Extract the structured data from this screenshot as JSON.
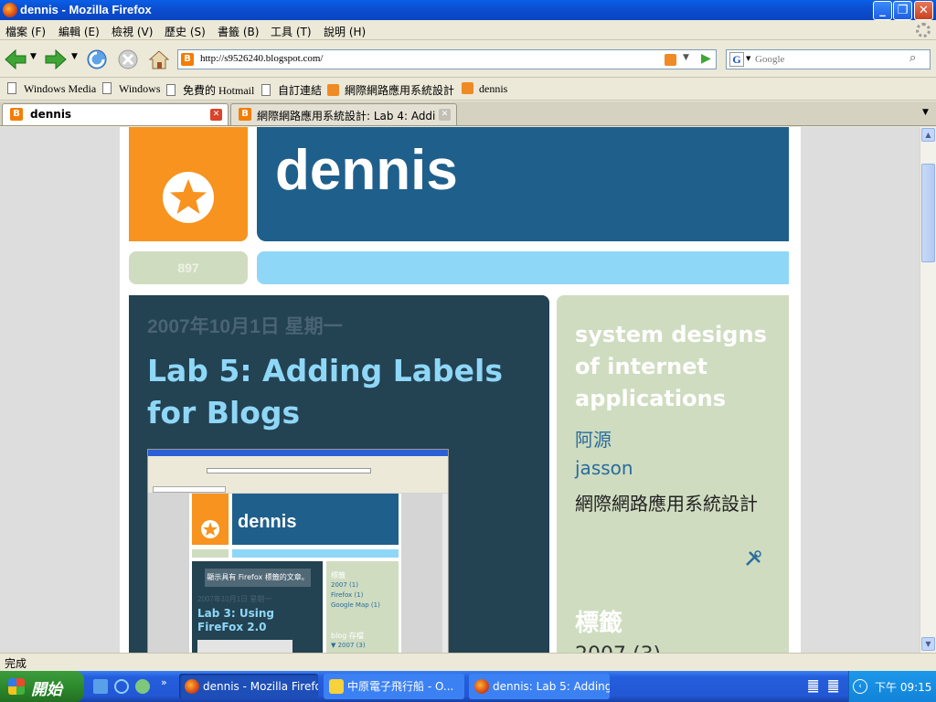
{
  "window": {
    "title": "dennis - Mozilla Firefox"
  },
  "menu": [
    {
      "label": "檔案 (F)"
    },
    {
      "label": "編輯 (E)"
    },
    {
      "label": "檢視 (V)"
    },
    {
      "label": "歷史 (S)"
    },
    {
      "label": "書籤 (B)"
    },
    {
      "label": "工具 (T)"
    },
    {
      "label": "說明 (H)"
    }
  ],
  "nav": {
    "url": "http://s9526240.blogspot.com/",
    "search_placeholder": "Google"
  },
  "bookmarks": [
    {
      "label": "Windows Media",
      "icon": "page-icon"
    },
    {
      "label": "Windows",
      "icon": "page-icon"
    },
    {
      "label": "免費的 Hotmail",
      "icon": "page-icon"
    },
    {
      "label": "自訂連結",
      "icon": "page-icon"
    },
    {
      "label": "網際網路應用系統設計",
      "icon": "rss-icon"
    },
    {
      "label": "dennis",
      "icon": "rss-icon"
    }
  ],
  "tabs": [
    {
      "label": "dennis",
      "active": true
    },
    {
      "label": "網際網路應用系統設計: Lab 4: Addi...",
      "active": false
    }
  ],
  "blog": {
    "title": "dennis",
    "counter": "897",
    "post_date": "2007年10月1日 星期一",
    "post_title": "Lab 5: Adding Labels for Blogs",
    "sidebar_title": "system designs of internet applications",
    "links": [
      "阿源",
      "jasson",
      "網際網路應用系統設計"
    ],
    "labels_heading": "標籤",
    "labels_partial": "2007 (3)"
  },
  "screenshot": {
    "title": "dennis",
    "notice": "顯示具有 Firefox 標籤的文章。",
    "date": "2007年10月1日 星期一",
    "post_title": "Lab 3: Using FireFox 2.0",
    "sidebar_heading": "標籤",
    "labels": [
      "2007 (1)",
      "Firefox (1)",
      "Google Map (1)"
    ],
    "archive_heading": "blog 存檔",
    "archive": [
      "▼ 2007 (3)"
    ]
  },
  "status": {
    "text": "完成"
  },
  "taskbar": {
    "start": "開始",
    "tasks": [
      {
        "label": "dennis - Mozilla Firefox"
      },
      {
        "label": "中原電子飛行船 - O..."
      },
      {
        "label": "dennis: Lab 5: Adding ..."
      }
    ],
    "clock": "下午 09:15"
  },
  "colors": {
    "blog_dark_blue": "#1f5f8b",
    "blog_orange": "#f7931e",
    "blog_navy": "#234252",
    "blog_sage": "#cfdcc0",
    "blog_light_blue": "#8fd7f7",
    "link_blue": "#2a6c9c"
  }
}
